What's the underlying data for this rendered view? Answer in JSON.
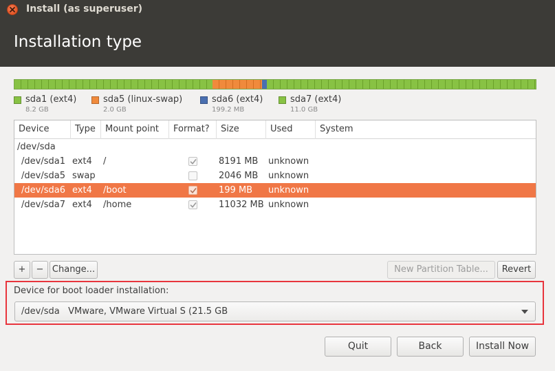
{
  "window": {
    "title": "Install (as superuser)"
  },
  "header": {
    "title": "Installation type"
  },
  "partition_bar": {
    "segments": [
      {
        "name": "sda1",
        "fraction": 0.38,
        "kind": "ext4"
      },
      {
        "name": "sda5",
        "fraction": 0.095,
        "kind": "swap"
      },
      {
        "name": "sda6",
        "fraction": 0.009,
        "kind": "boot"
      },
      {
        "name": "sda7",
        "fraction": 0.516,
        "kind": "ext4"
      }
    ]
  },
  "legend": [
    {
      "label": "sda1 (ext4)",
      "size": "8.2 GB",
      "color": "#88c244"
    },
    {
      "label": "sda5 (linux-swap)",
      "size": "2.0 GB",
      "color": "#f08a3c"
    },
    {
      "label": "sda6 (ext4)",
      "size": "199.2 MB",
      "color": "#4a6fb0"
    },
    {
      "label": "sda7 (ext4)",
      "size": "11.0 GB",
      "color": "#88c244"
    }
  ],
  "table": {
    "columns": [
      "Device",
      "Type",
      "Mount point",
      "Format?",
      "Size",
      "Used",
      "System"
    ],
    "group": "/dev/sda",
    "rows": [
      {
        "device": "/dev/sda1",
        "type": "ext4",
        "mount": "/",
        "format": true,
        "size": "8191 MB",
        "used": "unknown",
        "system": "",
        "selected": false
      },
      {
        "device": "/dev/sda5",
        "type": "swap",
        "mount": "",
        "format": false,
        "size": "2046 MB",
        "used": "unknown",
        "system": "",
        "selected": false
      },
      {
        "device": "/dev/sda6",
        "type": "ext4",
        "mount": "/boot",
        "format": true,
        "size": "199 MB",
        "used": "unknown",
        "system": "",
        "selected": true
      },
      {
        "device": "/dev/sda7",
        "type": "ext4",
        "mount": "/home",
        "format": true,
        "size": "11032 MB",
        "used": "unknown",
        "system": "",
        "selected": false
      }
    ]
  },
  "table_buttons": {
    "add": "+",
    "remove": "−",
    "change": "Change...",
    "new_table": "New Partition Table...",
    "revert": "Revert"
  },
  "bootloader": {
    "label": "Device for boot loader installation:",
    "value": "/dev/sda   VMware, VMware Virtual S (21.5 GB"
  },
  "footer": {
    "quit": "Quit",
    "back": "Back",
    "install": "Install Now"
  },
  "colors": {
    "selection": "#f07746",
    "highlight_border": "#e8343c",
    "header_bg": "#3c3b37"
  }
}
